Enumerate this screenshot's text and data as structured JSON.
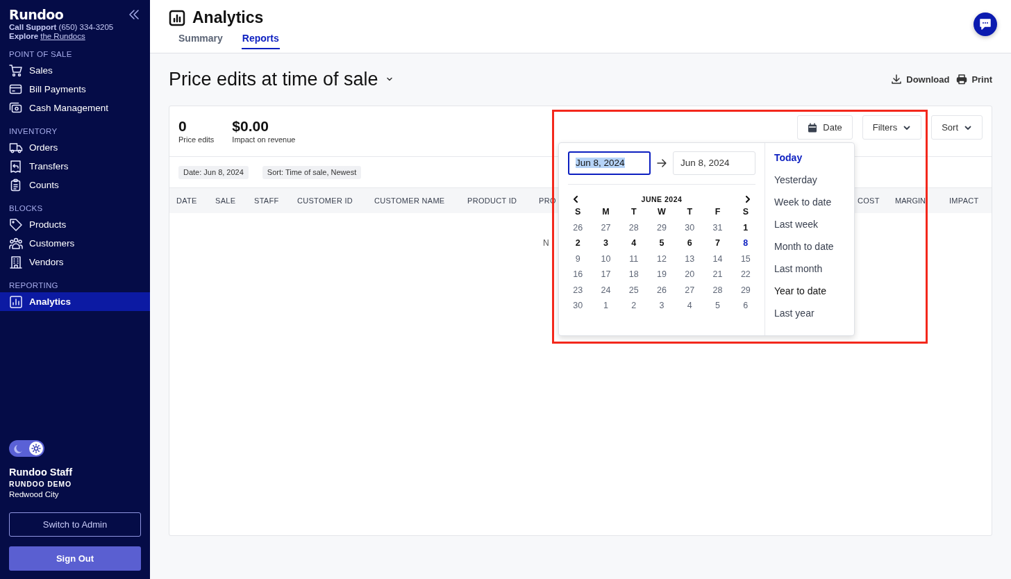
{
  "sidebar": {
    "brand": "Rundoo",
    "support_label": "Call Support",
    "support_phone": "(650) 334-3205",
    "explore_label": "Explore",
    "explore_link": "the Rundocs",
    "sections": [
      {
        "title": "POINT OF SALE",
        "items": [
          {
            "label": "Sales",
            "selected": false
          },
          {
            "label": "Bill Payments",
            "selected": false
          },
          {
            "label": "Cash Management",
            "selected": false
          }
        ]
      },
      {
        "title": "INVENTORY",
        "items": [
          {
            "label": "Orders",
            "selected": false
          },
          {
            "label": "Transfers",
            "selected": false
          },
          {
            "label": "Counts",
            "selected": false
          }
        ]
      },
      {
        "title": "BLOCKS",
        "items": [
          {
            "label": "Products",
            "selected": false
          },
          {
            "label": "Customers",
            "selected": false
          },
          {
            "label": "Vendors",
            "selected": false
          }
        ]
      },
      {
        "title": "REPORTING",
        "items": [
          {
            "label": "Analytics",
            "selected": true
          }
        ]
      }
    ],
    "theme_toggle": {
      "on": true
    },
    "user": {
      "name": "Rundoo Staff",
      "company": "RUNDOO DEMO",
      "location": "Redwood City"
    },
    "buttons": [
      "Switch to Admin",
      "Sign Out"
    ]
  },
  "header": {
    "title": "Analytics",
    "tabs": [
      {
        "label": "Summary",
        "selected": false
      },
      {
        "label": "Reports",
        "selected": true
      }
    ]
  },
  "report": {
    "title": "Price edits at time of sale",
    "actions": [
      "Download",
      "Print"
    ],
    "stats": [
      {
        "value": "0",
        "label": "Price edits"
      },
      {
        "value": "$0.00",
        "label": "Impact on revenue"
      }
    ],
    "controls": [
      "Date",
      "Filters",
      "Sort"
    ],
    "chips": [
      "Date: Jun 8, 2024",
      "Sort: Time of sale, Newest"
    ],
    "table": {
      "columns": [
        "DATE",
        "SALE",
        "STAFF",
        "CUSTOMER ID",
        "CUSTOMER NAME",
        "PRODUCT ID",
        "PRO",
        "COST",
        "MARGIN",
        "IMPACT"
      ],
      "empty_message": "N"
    }
  },
  "date_picker": {
    "start": "Jun 8, 2024",
    "end": "Jun 8, 2024",
    "month": "JUNE 2024",
    "weekdays": [
      "S",
      "M",
      "T",
      "W",
      "T",
      "F",
      "S"
    ],
    "days": [
      {
        "label": "26",
        "disabled": true,
        "selected": false
      },
      {
        "label": "27",
        "disabled": true,
        "selected": false
      },
      {
        "label": "28",
        "disabled": true,
        "selected": false
      },
      {
        "label": "29",
        "disabled": true,
        "selected": false
      },
      {
        "label": "30",
        "disabled": true,
        "selected": false
      },
      {
        "label": "31",
        "disabled": true,
        "selected": false
      },
      {
        "label": "1",
        "disabled": false,
        "selected": false
      },
      {
        "label": "2",
        "disabled": false,
        "selected": false
      },
      {
        "label": "3",
        "disabled": false,
        "selected": false
      },
      {
        "label": "4",
        "disabled": false,
        "selected": false
      },
      {
        "label": "5",
        "disabled": false,
        "selected": false
      },
      {
        "label": "6",
        "disabled": false,
        "selected": false
      },
      {
        "label": "7",
        "disabled": false,
        "selected": false
      },
      {
        "label": "8",
        "disabled": false,
        "selected": true
      },
      {
        "label": "9",
        "disabled": true,
        "selected": false
      },
      {
        "label": "10",
        "disabled": true,
        "selected": false
      },
      {
        "label": "11",
        "disabled": true,
        "selected": false
      },
      {
        "label": "12",
        "disabled": true,
        "selected": false
      },
      {
        "label": "13",
        "disabled": true,
        "selected": false
      },
      {
        "label": "14",
        "disabled": true,
        "selected": false
      },
      {
        "label": "15",
        "disabled": true,
        "selected": false
      },
      {
        "label": "16",
        "disabled": true,
        "selected": false
      },
      {
        "label": "17",
        "disabled": true,
        "selected": false
      },
      {
        "label": "18",
        "disabled": true,
        "selected": false
      },
      {
        "label": "19",
        "disabled": true,
        "selected": false
      },
      {
        "label": "20",
        "disabled": true,
        "selected": false
      },
      {
        "label": "21",
        "disabled": true,
        "selected": false
      },
      {
        "label": "22",
        "disabled": true,
        "selected": false
      },
      {
        "label": "23",
        "disabled": true,
        "selected": false
      },
      {
        "label": "24",
        "disabled": true,
        "selected": false
      },
      {
        "label": "25",
        "disabled": true,
        "selected": false
      },
      {
        "label": "26",
        "disabled": true,
        "selected": false
      },
      {
        "label": "27",
        "disabled": true,
        "selected": false
      },
      {
        "label": "28",
        "disabled": true,
        "selected": false
      },
      {
        "label": "29",
        "disabled": true,
        "selected": false
      },
      {
        "label": "30",
        "disabled": true,
        "selected": false
      },
      {
        "label": "1",
        "disabled": true,
        "selected": false
      },
      {
        "label": "2",
        "disabled": true,
        "selected": false
      },
      {
        "label": "3",
        "disabled": true,
        "selected": false
      },
      {
        "label": "4",
        "disabled": true,
        "selected": false
      },
      {
        "label": "5",
        "disabled": true,
        "selected": false
      },
      {
        "label": "6",
        "disabled": true,
        "selected": false
      }
    ],
    "presets": [
      {
        "label": "Today",
        "selected": true,
        "hovered": false
      },
      {
        "label": "Yesterday",
        "selected": false,
        "hovered": false
      },
      {
        "label": "Week to date",
        "selected": false,
        "hovered": false
      },
      {
        "label": "Last week",
        "selected": false,
        "hovered": false
      },
      {
        "label": "Month to date",
        "selected": false,
        "hovered": false
      },
      {
        "label": "Last month",
        "selected": false,
        "hovered": false
      },
      {
        "label": "Year to date",
        "selected": false,
        "hovered": true
      },
      {
        "label": "Last year",
        "selected": false,
        "hovered": false
      }
    ]
  }
}
